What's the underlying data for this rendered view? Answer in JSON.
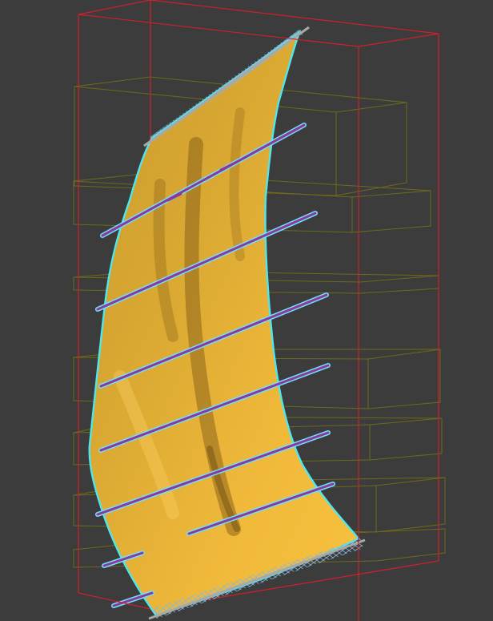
{
  "viewport": {
    "view": "perspective",
    "background": "#3c3c3c",
    "colors": {
      "bounding_box": "#d0202a",
      "shelf_wireframe": "#6e6a1c",
      "cloth_fill": "#f2b83a",
      "cloth_shadow": "#9a7020",
      "cloth_outline": "#4fe6ee",
      "rod": "#8c3a96",
      "rod_outline": "#6fe0ff",
      "pin_cross": "#8ab8d8",
      "bar": "#a8a8a8"
    },
    "objects": [
      {
        "name": "bounding-box",
        "type": "wireframe-box"
      },
      {
        "name": "shelf-stack",
        "type": "wireframe-boxes",
        "count": 6
      },
      {
        "name": "cloth",
        "type": "cloth-mesh"
      },
      {
        "name": "rods",
        "type": "cylinder",
        "count": 8
      },
      {
        "name": "top-bar",
        "type": "cylinder"
      },
      {
        "name": "bottom-bar",
        "type": "cylinder"
      }
    ]
  }
}
